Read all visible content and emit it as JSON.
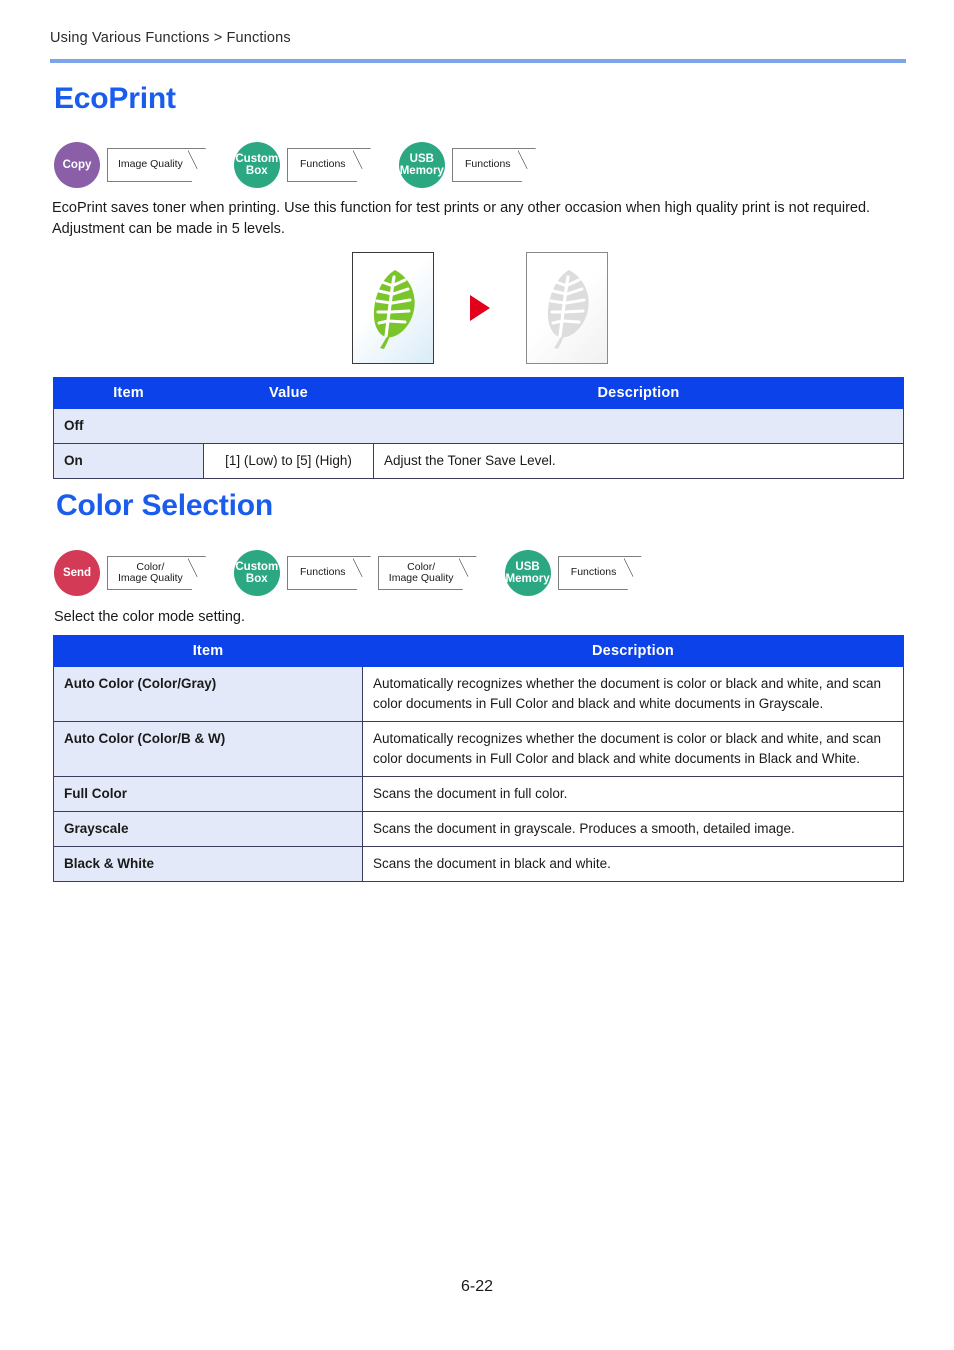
{
  "header": {
    "breadcrumb": "Using Various Functions > Functions"
  },
  "footer": {
    "page_number": "6-22"
  },
  "colors": {
    "heading_blue": "#1A5CEB",
    "rule_blue": "#7BA4EA",
    "table_header_blue": "#0B42EA",
    "table_tint": "#E3E9F8",
    "copy_purple": "#8B5FA8",
    "send_crimson": "#D23A55",
    "green_teal": "#2BA882",
    "leaf_green": "#7AC52A",
    "leaf_gray": "#DCDCDC",
    "arrow_red": "#E3001B"
  },
  "sections": [
    {
      "id": "ecoprint",
      "title": "EcoPrint",
      "badges": [
        {
          "circle": {
            "lines": [
              "Copy"
            ],
            "color_name": "copy_purple"
          },
          "tags": [
            {
              "lines": [
                "Image Quality"
              ]
            }
          ]
        },
        {
          "circle": {
            "lines": [
              "Custom",
              "Box"
            ],
            "color_name": "green_teal"
          },
          "tags": [
            {
              "lines": [
                "Functions"
              ]
            }
          ]
        },
        {
          "circle": {
            "lines": [
              "USB",
              "Memory"
            ],
            "color_name": "green_teal"
          },
          "tags": [
            {
              "lines": [
                "Functions"
              ]
            }
          ]
        }
      ],
      "paragraph": "EcoPrint saves toner when printing. Use this function for test prints or any other occasion when high quality print is not required. Adjustment can be made in 5 levels.",
      "illustration": {
        "before_alt": "green-leaf",
        "arrow_alt": "right-arrow",
        "after_alt": "faded-gray-leaf"
      },
      "table": {
        "headers": [
          "Item",
          "Value",
          "Description"
        ],
        "rows": [
          {
            "item": "Off",
            "value": "",
            "description": "",
            "merged": true
          },
          {
            "item": "On",
            "value": "[1] (Low) to [5] (High)",
            "description": "Adjust the Toner Save Level.",
            "merged": false
          }
        ]
      }
    },
    {
      "id": "color-selection",
      "title": "Color Selection",
      "badges": [
        {
          "circle": {
            "lines": [
              "Send"
            ],
            "color_name": "send_crimson"
          },
          "tags": [
            {
              "lines": [
                "Color/",
                "Image Quality"
              ]
            }
          ]
        },
        {
          "circle": {
            "lines": [
              "Custom",
              "Box"
            ],
            "color_name": "green_teal"
          },
          "tags": [
            {
              "lines": [
                "Functions"
              ]
            },
            {
              "lines": [
                "Color/",
                "Image Quality"
              ]
            }
          ]
        },
        {
          "circle": {
            "lines": [
              "USB",
              "Memory"
            ],
            "color_name": "green_teal"
          },
          "tags": [
            {
              "lines": [
                "Functions"
              ]
            }
          ]
        }
      ],
      "paragraph": "Select the color mode setting.",
      "table": {
        "headers": [
          "Item",
          "Description"
        ],
        "rows": [
          {
            "item": "Auto Color (Color/Gray)",
            "description": "Automatically recognizes whether the document is color or black and white, and scan color documents in Full Color and black and white documents in Grayscale."
          },
          {
            "item": "Auto Color (Color/B & W)",
            "description": "Automatically recognizes whether the document is color or black and white, and scan color documents in Full Color and black and white documents in Black and White."
          },
          {
            "item": "Full Color",
            "description": "Scans the document in full color."
          },
          {
            "item": "Grayscale",
            "description": "Scans the document in grayscale. Produces a smooth, detailed image."
          },
          {
            "item": "Black & White",
            "description": "Scans the document in black and white."
          }
        ]
      }
    }
  ]
}
